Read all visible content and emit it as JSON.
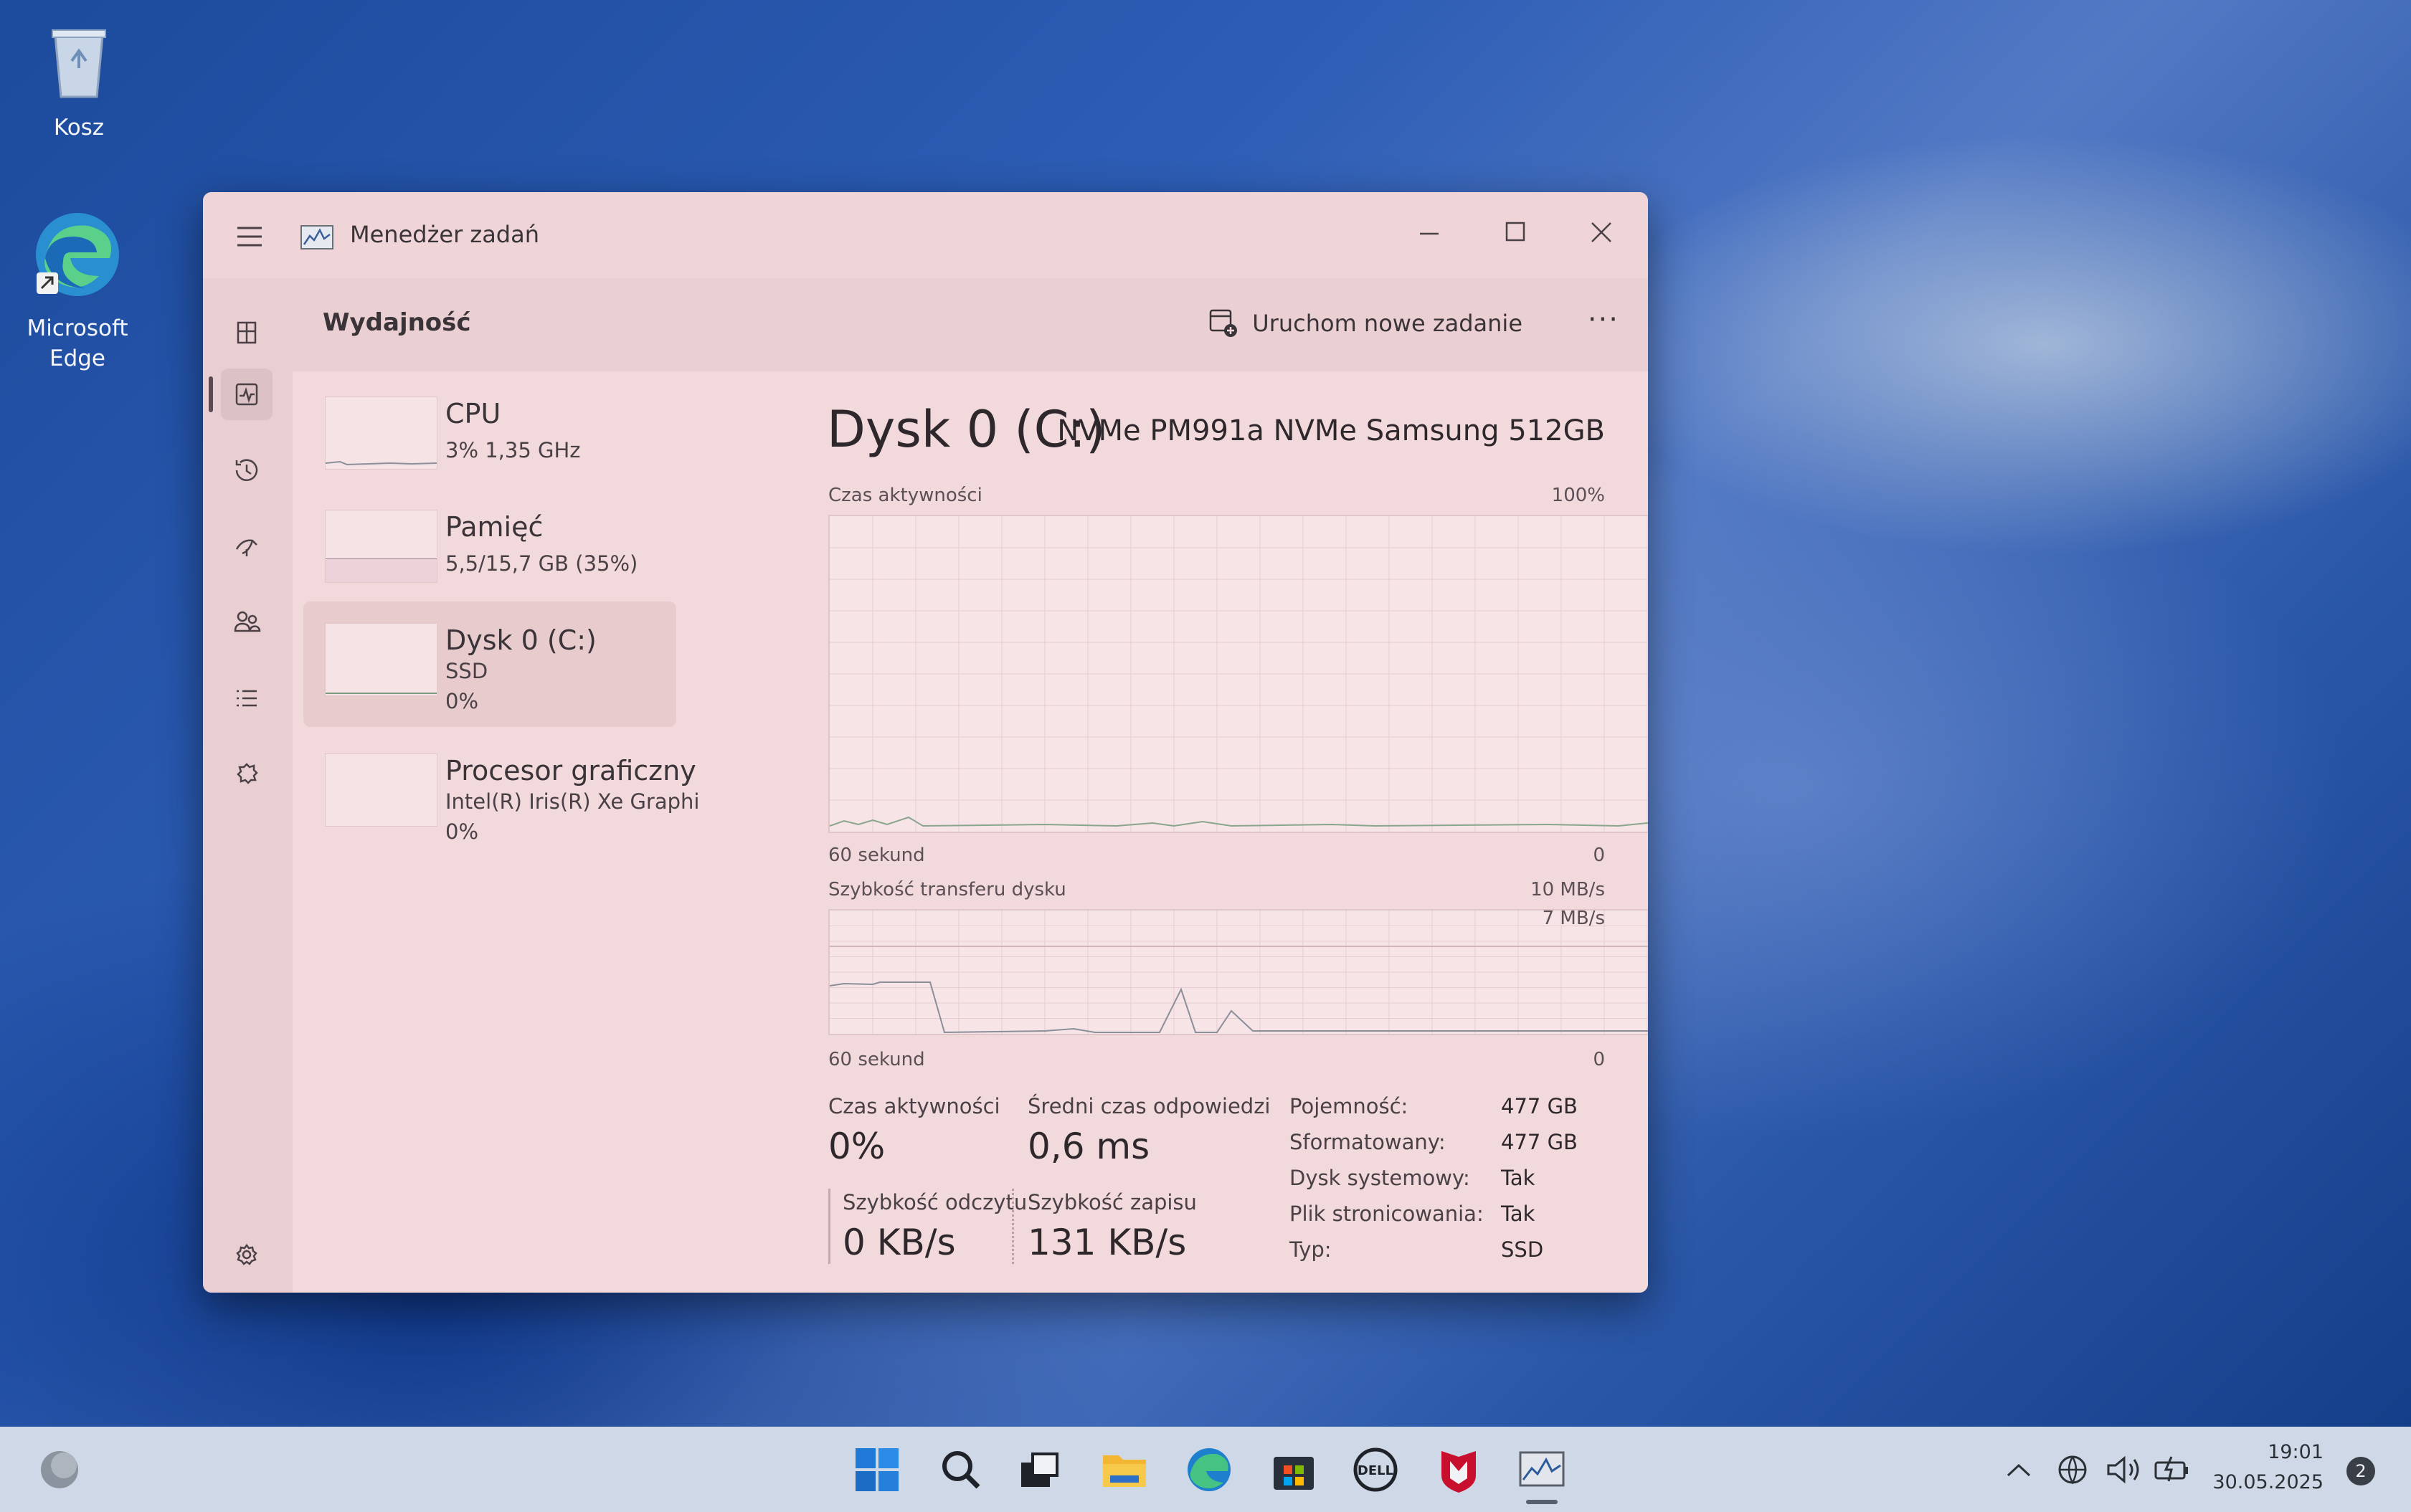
{
  "desktop": {
    "icons": [
      {
        "label": "Kosz"
      },
      {
        "label": "Microsoft Edge"
      }
    ]
  },
  "window": {
    "title": "Menedżer zadań",
    "page_title": "Wydajność",
    "run_new_task": "Uruchom nowe zadanie",
    "more": "···"
  },
  "sidebar": {
    "items": [
      {
        "name": "CPU",
        "sub1": "3% 1,35 GHz",
        "sub2": ""
      },
      {
        "name": "Pamięć",
        "sub1": "5,5/15,7 GB (35%)",
        "sub2": ""
      },
      {
        "name": "Dysk 0 (C:)",
        "sub1": "SSD",
        "sub2": "0%"
      },
      {
        "name": "Procesor graficzny",
        "sub1": "Intel(R) Iris(R) Xe Graphi",
        "sub2": "0%"
      }
    ]
  },
  "disk": {
    "title": "Dysk 0 (C:)",
    "model": "NVMe PM991a NVMe Samsung 512GB",
    "graph1": {
      "label": "Czas aktywności",
      "max": "100%",
      "time": "60 sekund",
      "min": "0"
    },
    "graph2": {
      "label": "Szybkość transferu dysku",
      "max": "10 MB/s",
      "mid": "7 MB/s",
      "time": "60 sekund",
      "min": "0"
    },
    "stats": {
      "active_time_label": "Czas aktywności",
      "active_time_value": "0%",
      "avg_response_label": "Średni czas odpowiedzi",
      "avg_response_value": "0,6 ms",
      "read_label": "Szybkość odczytu",
      "read_value": "0 KB/s",
      "write_label": "Szybkość zapisu",
      "write_value": "131 KB/s"
    },
    "properties": [
      {
        "key": "Pojemność:",
        "value": "477 GB"
      },
      {
        "key": "Sformatowany:",
        "value": "477 GB"
      },
      {
        "key": "Dysk systemowy:",
        "value": "Tak"
      },
      {
        "key": "Plik stronicowania:",
        "value": "Tak"
      },
      {
        "key": "Typ:",
        "value": "SSD"
      }
    ]
  },
  "taskbar": {
    "time": "19:01",
    "date": "30.05.2025",
    "notification_count": "2"
  }
}
